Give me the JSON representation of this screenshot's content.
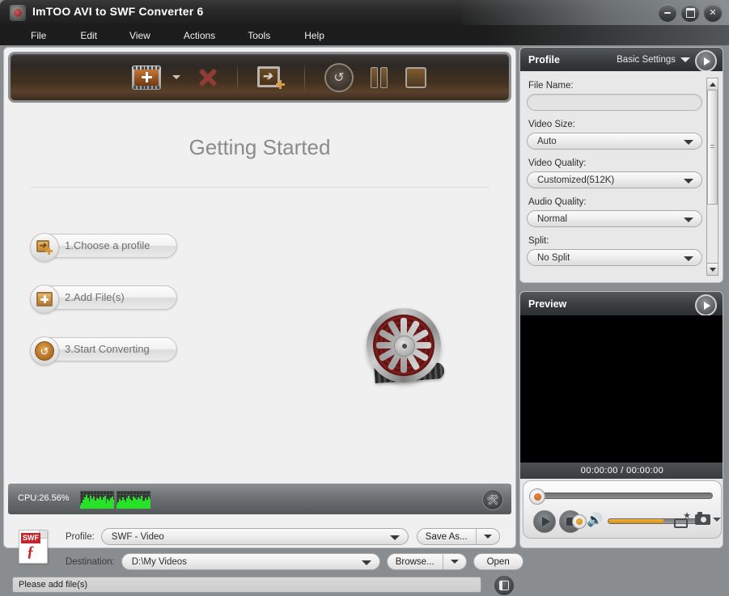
{
  "window": {
    "title": "ImTOO AVI to SWF Converter 6",
    "app_icon": "film-reel-app-icon",
    "controls": {
      "minimize": "minimize",
      "maximize": "maximize",
      "close": "close"
    }
  },
  "menu": {
    "items": [
      {
        "label": "File"
      },
      {
        "label": "Edit"
      },
      {
        "label": "View"
      },
      {
        "label": "Actions"
      },
      {
        "label": "Tools"
      },
      {
        "label": "Help"
      }
    ]
  },
  "toolbar": {
    "buttons": [
      {
        "name": "add-file",
        "icon": "filmstrip-plus-icon"
      },
      {
        "name": "add-file-dropdown",
        "icon": "caret-down-icon"
      },
      {
        "name": "remove-file",
        "icon": "red-x-icon"
      },
      {
        "name": "add-to-conversion-list",
        "icon": "film-arrow-plus-icon"
      },
      {
        "name": "convert",
        "icon": "circular-arrow-icon"
      },
      {
        "name": "pause",
        "icon": "pause-icon"
      },
      {
        "name": "stop",
        "icon": "stop-icon"
      }
    ]
  },
  "getting_started": {
    "title": "Getting Started",
    "steps": [
      {
        "label": "1.Choose a profile",
        "icon": "profile-icon"
      },
      {
        "label": "2.Add File(s)",
        "icon": "add-file-icon"
      },
      {
        "label": "3.Start Converting",
        "icon": "convert-icon"
      }
    ],
    "illustration": "film-reel-illustration"
  },
  "cpu": {
    "label": "CPU:26.56%",
    "graph_bars_1": [
      4,
      7,
      5,
      11,
      6,
      14,
      8,
      17,
      7,
      13,
      9,
      16,
      6,
      12,
      8,
      15,
      7,
      10,
      6,
      13,
      9,
      12,
      7,
      15,
      8,
      11,
      6,
      14,
      9,
      16,
      7,
      12,
      8,
      10,
      6,
      13,
      9,
      15,
      7,
      11
    ],
    "graph_bars_2": [
      5,
      8,
      6,
      12,
      7,
      10,
      9,
      14,
      6,
      11,
      8,
      13,
      7,
      16,
      9,
      12,
      6,
      10,
      8,
      15,
      7,
      13,
      9,
      11,
      6,
      14,
      8,
      12,
      7,
      16,
      9,
      10,
      6,
      13,
      8,
      11,
      7,
      15,
      9,
      12
    ],
    "tools_button": "tools-icon"
  },
  "output": {
    "file_icon": "swf-file-icon",
    "file_icon_label": "SWF",
    "profile_label": "Profile:",
    "profile_value": "SWF - Video",
    "save_as_label": "Save As...",
    "destination_label": "Destination:",
    "destination_value": "D:\\My Videos",
    "browse_label": "Browse...",
    "open_label": "Open"
  },
  "status": {
    "text": "Please add file(s)",
    "button_icon": "list-view-icon"
  },
  "profile_panel": {
    "title": "Profile",
    "settings_mode": "Basic Settings",
    "go_button": "expand-arrow-icon",
    "fields": [
      {
        "label": "File Name:",
        "type": "text",
        "value": ""
      },
      {
        "label": "Video Size:",
        "type": "select",
        "value": "Auto"
      },
      {
        "label": "Video Quality:",
        "type": "select",
        "value": "Customized(512K)"
      },
      {
        "label": "Audio Quality:",
        "type": "select",
        "value": "Normal"
      },
      {
        "label": "Split:",
        "type": "select",
        "value": "No Split"
      }
    ]
  },
  "preview_panel": {
    "title": "Preview",
    "go_button": "expand-arrow-icon",
    "time": "00:00:00 / 00:00:00",
    "controls": {
      "play": "play-icon",
      "stop": "stop-icon",
      "volume": "speaker-icon",
      "snapshot_series": "snapshot-series-icon",
      "snapshot": "camera-icon",
      "snapshot_dropdown": "caret-down-icon"
    }
  },
  "colors": {
    "accent_orange": "#d98f18",
    "toolbar_brown": "#42301f",
    "panel_header": "#3c3f41",
    "cpu_green": "#27e327",
    "swf_red": "#c1272d"
  }
}
